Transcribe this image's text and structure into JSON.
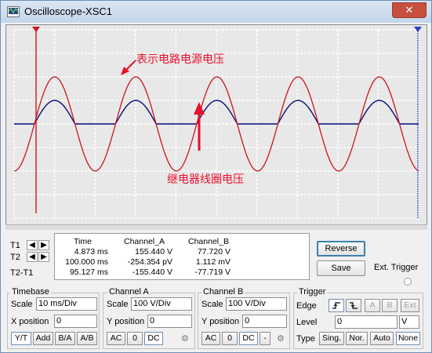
{
  "window": {
    "title": "Oscilloscope-XSC1",
    "close_glyph": "✕"
  },
  "annotations": {
    "source_voltage": "表示电路电源电压",
    "coil_voltage": "继电器线圈电压"
  },
  "trace_colors": {
    "channel_a": "#c8161e",
    "channel_b": "#0a0a78",
    "cursor_t1": "#d0141c",
    "cursor_t2": "#3040c0"
  },
  "cursors": {
    "t1_label": "T1",
    "t2_label": "T2",
    "diff_label": "T2-T1",
    "headers": [
      "Time",
      "Channel_A",
      "Channel_B"
    ],
    "rows": [
      {
        "time": "4.873 ms",
        "a": "155.440 V",
        "b": "77.720 V"
      },
      {
        "time": "100.000 ms",
        "a": "-254.354 pV",
        "b": "1.112 mV"
      },
      {
        "time": "95.127 ms",
        "a": "-155.440 V",
        "b": "-77.719 V"
      }
    ]
  },
  "buttons": {
    "reverse": "Reverse",
    "save": "Save",
    "ext_trigger": "Ext. Trigger"
  },
  "timebase": {
    "title": "Timebase",
    "scale_label": "Scale",
    "scale_value": "10 ms/Div",
    "xpos_label": "X position",
    "xpos_value": "0",
    "modes": [
      "Y/T",
      "Add",
      "B/A",
      "A/B"
    ]
  },
  "channel_a": {
    "title": "Channel A",
    "scale_label": "Scale",
    "scale_value": "100  V/Div",
    "ypos_label": "Y position",
    "ypos_value": "0",
    "coupling": [
      "AC",
      "0",
      "DC"
    ]
  },
  "channel_b": {
    "title": "Channel B",
    "scale_label": "Scale",
    "scale_value": "100  V/Div",
    "ypos_label": "Y position",
    "ypos_value": "0",
    "coupling": [
      "AC",
      "0",
      "DC",
      "-"
    ]
  },
  "trigger": {
    "title": "Trigger",
    "edge_label": "Edge",
    "edge_buttons": [
      "A",
      "B",
      "Ext"
    ],
    "level_label": "Level",
    "level_value": "0",
    "level_unit": "V",
    "type_label": "Type",
    "types": [
      "Sing.",
      "Nor.",
      "Auto",
      "None"
    ]
  }
}
